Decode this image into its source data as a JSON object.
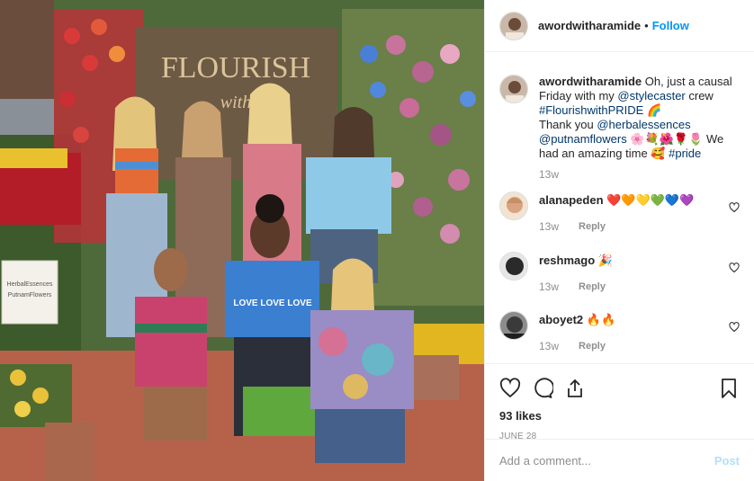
{
  "photo": {
    "sign_line1": "FLOURISH",
    "sign_line2": "with",
    "easel_line1": "HerbalEssences",
    "easel_line2": "PutnamFlowers",
    "shirt_text": "LOVE LOVE LOVE"
  },
  "header": {
    "username": "awordwitharamide",
    "separator": "•",
    "follow_label": "Follow"
  },
  "caption": {
    "username": "awordwitharamide",
    "text_1": "Oh, just a causal Friday with my",
    "mention_1": "@stylecaster",
    "text_2": "crew",
    "hashtag_1": "#FlourishwithPRIDE",
    "emoji_1": "🌈",
    "text_3": "Thank you",
    "mention_2": "@herbalessences",
    "mention_3": "@putnamflowers",
    "emoji_2": "🌸💐🌺🌹🌷",
    "text_4": "We had an amazing time",
    "emoji_3": "🥰",
    "hashtag_2": "#pride",
    "time": "13w"
  },
  "comments": [
    {
      "username": "alanapeden",
      "text": "❤️🧡💛💚💙💜",
      "time": "13w",
      "reply": "Reply",
      "avatar_color": "#d9a382"
    },
    {
      "username": "reshmago",
      "text": "🎉",
      "time": "13w",
      "reply": "Reply",
      "avatar_color": "#2a2a2a"
    },
    {
      "username": "aboyet2",
      "text": "🔥🔥",
      "time": "13w",
      "reply": "Reply",
      "avatar_color": "#3a3a3a"
    }
  ],
  "likes": "93 likes",
  "date": "JUNE 28",
  "add_comment": {
    "placeholder": "Add a comment...",
    "post_label": "Post"
  },
  "colors": {
    "link": "#00376b",
    "follow": "#0095f6",
    "post_disabled": "#b2dffc",
    "muted": "#8e8e8e",
    "border": "#efefef"
  }
}
